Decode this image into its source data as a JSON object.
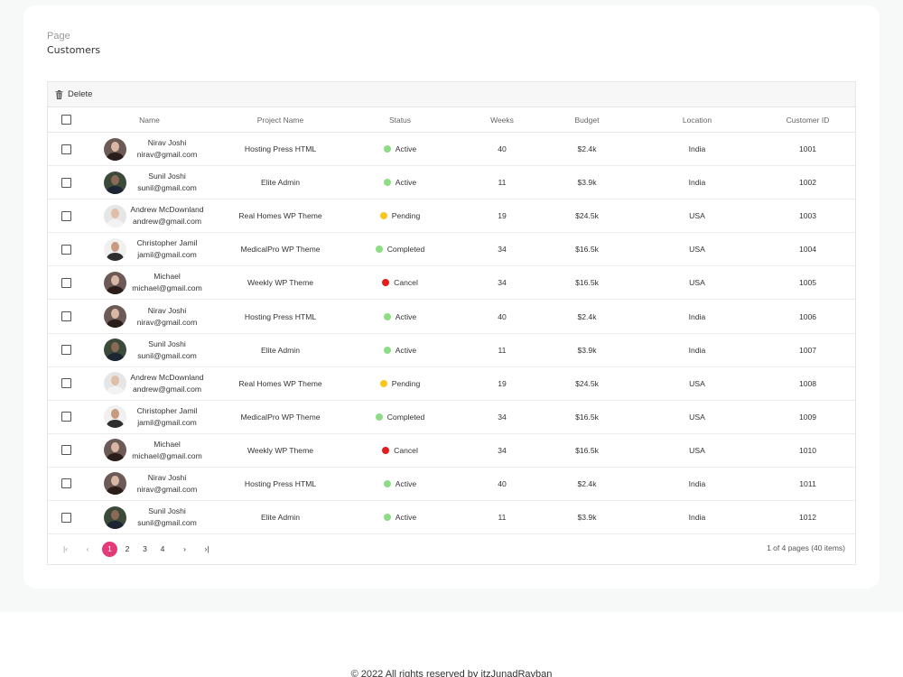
{
  "breadcrumb": {
    "label": "Page",
    "title": "Customers"
  },
  "toolbar": {
    "delete_label": "Delete"
  },
  "columns": [
    "Name",
    "Project Name",
    "Status",
    "Weeks",
    "Budget",
    "Location",
    "Customer ID"
  ],
  "status_colors": {
    "Active": "#8ddc86",
    "Pending": "#f7c71c",
    "Completed": "#8ddc86",
    "Cancel": "#e31c1c"
  },
  "rows": [
    {
      "name": "Nirav Joshi",
      "email": "nirav@gmail.com",
      "avatar": "woman",
      "project": "Hosting Press HTML",
      "status": "Active",
      "weeks": "40",
      "budget": "$2.4k",
      "location": "India",
      "id": "1001"
    },
    {
      "name": "Sunil Joshi",
      "email": "sunil@gmail.com",
      "avatar": "man-dark",
      "project": "Elite Admin",
      "status": "Active",
      "weeks": "11",
      "budget": "$3.9k",
      "location": "India",
      "id": "1002"
    },
    {
      "name": "Andrew McDownland",
      "email": "andrew@gmail.com",
      "avatar": "man-light",
      "project": "Real Homes WP Theme",
      "status": "Pending",
      "weeks": "19",
      "budget": "$24.5k",
      "location": "USA",
      "id": "1003"
    },
    {
      "name": "Christopher Jamil",
      "email": "jamil@gmail.com",
      "avatar": "man-curly",
      "project": "MedicalPro WP Theme",
      "status": "Completed",
      "weeks": "34",
      "budget": "$16.5k",
      "location": "USA",
      "id": "1004"
    },
    {
      "name": "Michael",
      "email": "michael@gmail.com",
      "avatar": "woman",
      "project": "Weekly WP Theme",
      "status": "Cancel",
      "weeks": "34",
      "budget": "$16.5k",
      "location": "USA",
      "id": "1005"
    },
    {
      "name": "Nirav Joshi",
      "email": "nirav@gmail.com",
      "avatar": "woman",
      "project": "Hosting Press HTML",
      "status": "Active",
      "weeks": "40",
      "budget": "$2.4k",
      "location": "India",
      "id": "1006"
    },
    {
      "name": "Sunil Joshi",
      "email": "sunil@gmail.com",
      "avatar": "man-dark",
      "project": "Elite Admin",
      "status": "Active",
      "weeks": "11",
      "budget": "$3.9k",
      "location": "India",
      "id": "1007"
    },
    {
      "name": "Andrew McDownland",
      "email": "andrew@gmail.com",
      "avatar": "man-light",
      "project": "Real Homes WP Theme",
      "status": "Pending",
      "weeks": "19",
      "budget": "$24.5k",
      "location": "USA",
      "id": "1008"
    },
    {
      "name": "Christopher Jamil",
      "email": "jamil@gmail.com",
      "avatar": "man-curly",
      "project": "MedicalPro WP Theme",
      "status": "Completed",
      "weeks": "34",
      "budget": "$16.5k",
      "location": "USA",
      "id": "1009"
    },
    {
      "name": "Michael",
      "email": "michael@gmail.com",
      "avatar": "woman",
      "project": "Weekly WP Theme",
      "status": "Cancel",
      "weeks": "34",
      "budget": "$16.5k",
      "location": "USA",
      "id": "1010"
    },
    {
      "name": "Nirav Joshi",
      "email": "nirav@gmail.com",
      "avatar": "woman",
      "project": "Hosting Press HTML",
      "status": "Active",
      "weeks": "40",
      "budget": "$2.4k",
      "location": "India",
      "id": "1011"
    },
    {
      "name": "Sunil Joshi",
      "email": "sunil@gmail.com",
      "avatar": "man-dark",
      "project": "Elite Admin",
      "status": "Active",
      "weeks": "11",
      "budget": "$3.9k",
      "location": "India",
      "id": "1012"
    }
  ],
  "pagination": {
    "first": "|‹",
    "prev": "‹",
    "pages": [
      "1",
      "2",
      "3",
      "4"
    ],
    "current": "1",
    "next": "›",
    "last": "›|",
    "info": "1 of 4 pages (40 items)"
  },
  "footer": {
    "text": "© 2022 All rights reserved by itzJunadRayban"
  }
}
